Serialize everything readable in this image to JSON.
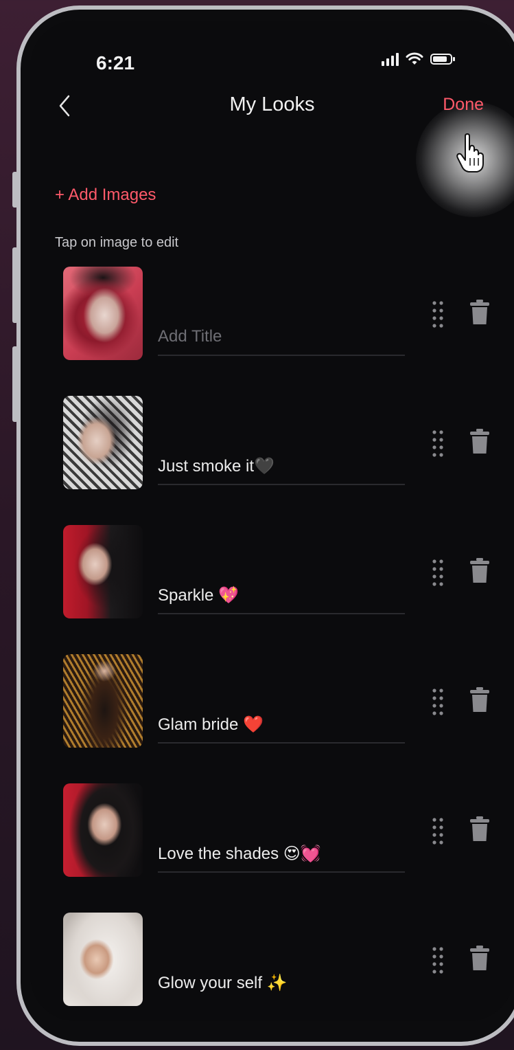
{
  "status_bar": {
    "time": "6:21"
  },
  "header": {
    "title": "My Looks",
    "done_label": "Done"
  },
  "actions": {
    "add_images_label": "+ Add Images",
    "hint": "Tap on image to edit"
  },
  "colors": {
    "accent": "#ff5a6a",
    "background": "#0b0b0d"
  },
  "icons": {
    "back": "chevron-left-icon",
    "drag": "drag-handle-icon",
    "delete": "trash-icon",
    "cursor": "hand-pointer-icon"
  },
  "looks": [
    {
      "title": "",
      "placeholder": "Add Title"
    },
    {
      "title": "Just smoke it🖤"
    },
    {
      "title": "Sparkle 💖"
    },
    {
      "title": "Glam bride ❤️"
    },
    {
      "title": "Love the shades 😍💓"
    },
    {
      "title": "Glow your self ✨"
    }
  ]
}
